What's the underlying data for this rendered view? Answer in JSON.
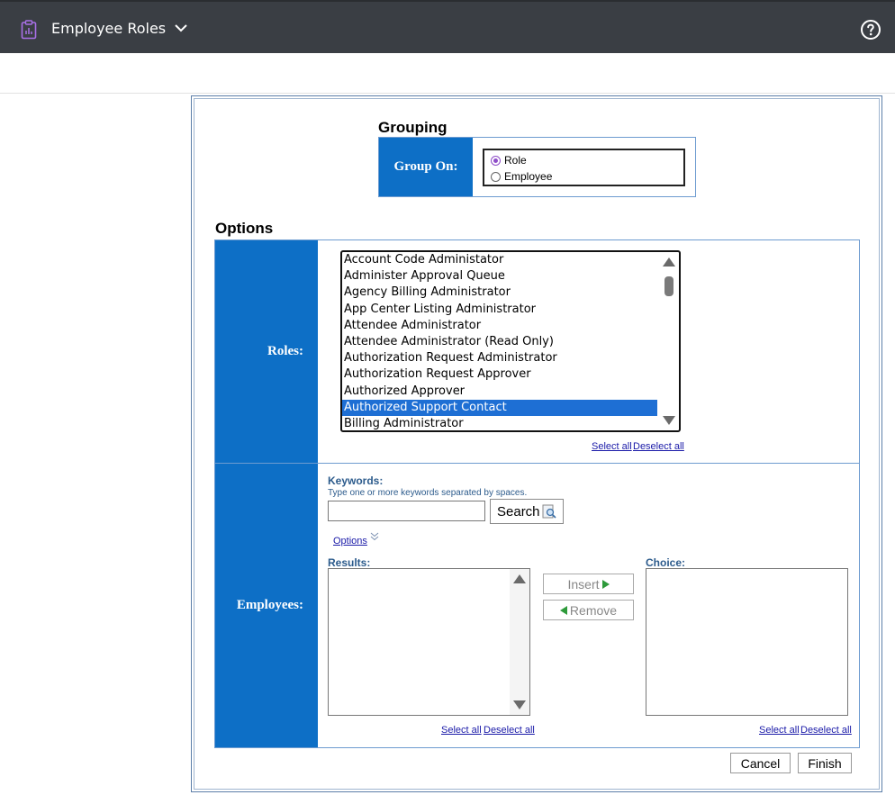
{
  "header": {
    "title": "Employee Roles",
    "app_icon": "clipboard-report-icon",
    "help_icon": "help-circle-icon"
  },
  "grouping": {
    "heading": "Grouping",
    "label": "Group On:",
    "options": [
      {
        "label": "Role",
        "selected": true
      },
      {
        "label": "Employee",
        "selected": false
      }
    ]
  },
  "options": {
    "heading": "Options",
    "roles": {
      "label": "Roles:",
      "items": [
        "Account Code Administator",
        "Administer Approval Queue",
        "Agency Billing Administrator",
        "App Center Listing Administrator",
        "Attendee Administrator",
        "Attendee Administrator (Read Only)",
        "Authorization Request Administrator",
        "Authorization Request Approver",
        "Authorized Approver",
        "Authorized Support Contact",
        "Billing Administrator"
      ],
      "selected_item": "Authorized Support Contact",
      "select_all": "Select all",
      "deselect_all": "Deselect all"
    },
    "employees": {
      "label": "Employees:",
      "keywords_label": "Keywords:",
      "keywords_hint": "Type one or more keywords separated by spaces.",
      "keywords_value": "",
      "search_label": "Search",
      "options_link": "Options",
      "results_label": "Results:",
      "choice_label": "Choice:",
      "insert_label": "Insert",
      "remove_label": "Remove",
      "results_select_all": "Select all",
      "results_deselect_all": "Deselect all",
      "choice_select_all": "Select all",
      "choice_deselect_all": "Deselect all"
    }
  },
  "footer": {
    "cancel_label": "Cancel",
    "finish_label": "Finish"
  },
  "colors": {
    "topbar": "#3a3e44",
    "label_cell": "#0d6fc6",
    "selection": "#1e6fd4",
    "app_icon": "#a970e8",
    "link": "#1a1aa8"
  }
}
